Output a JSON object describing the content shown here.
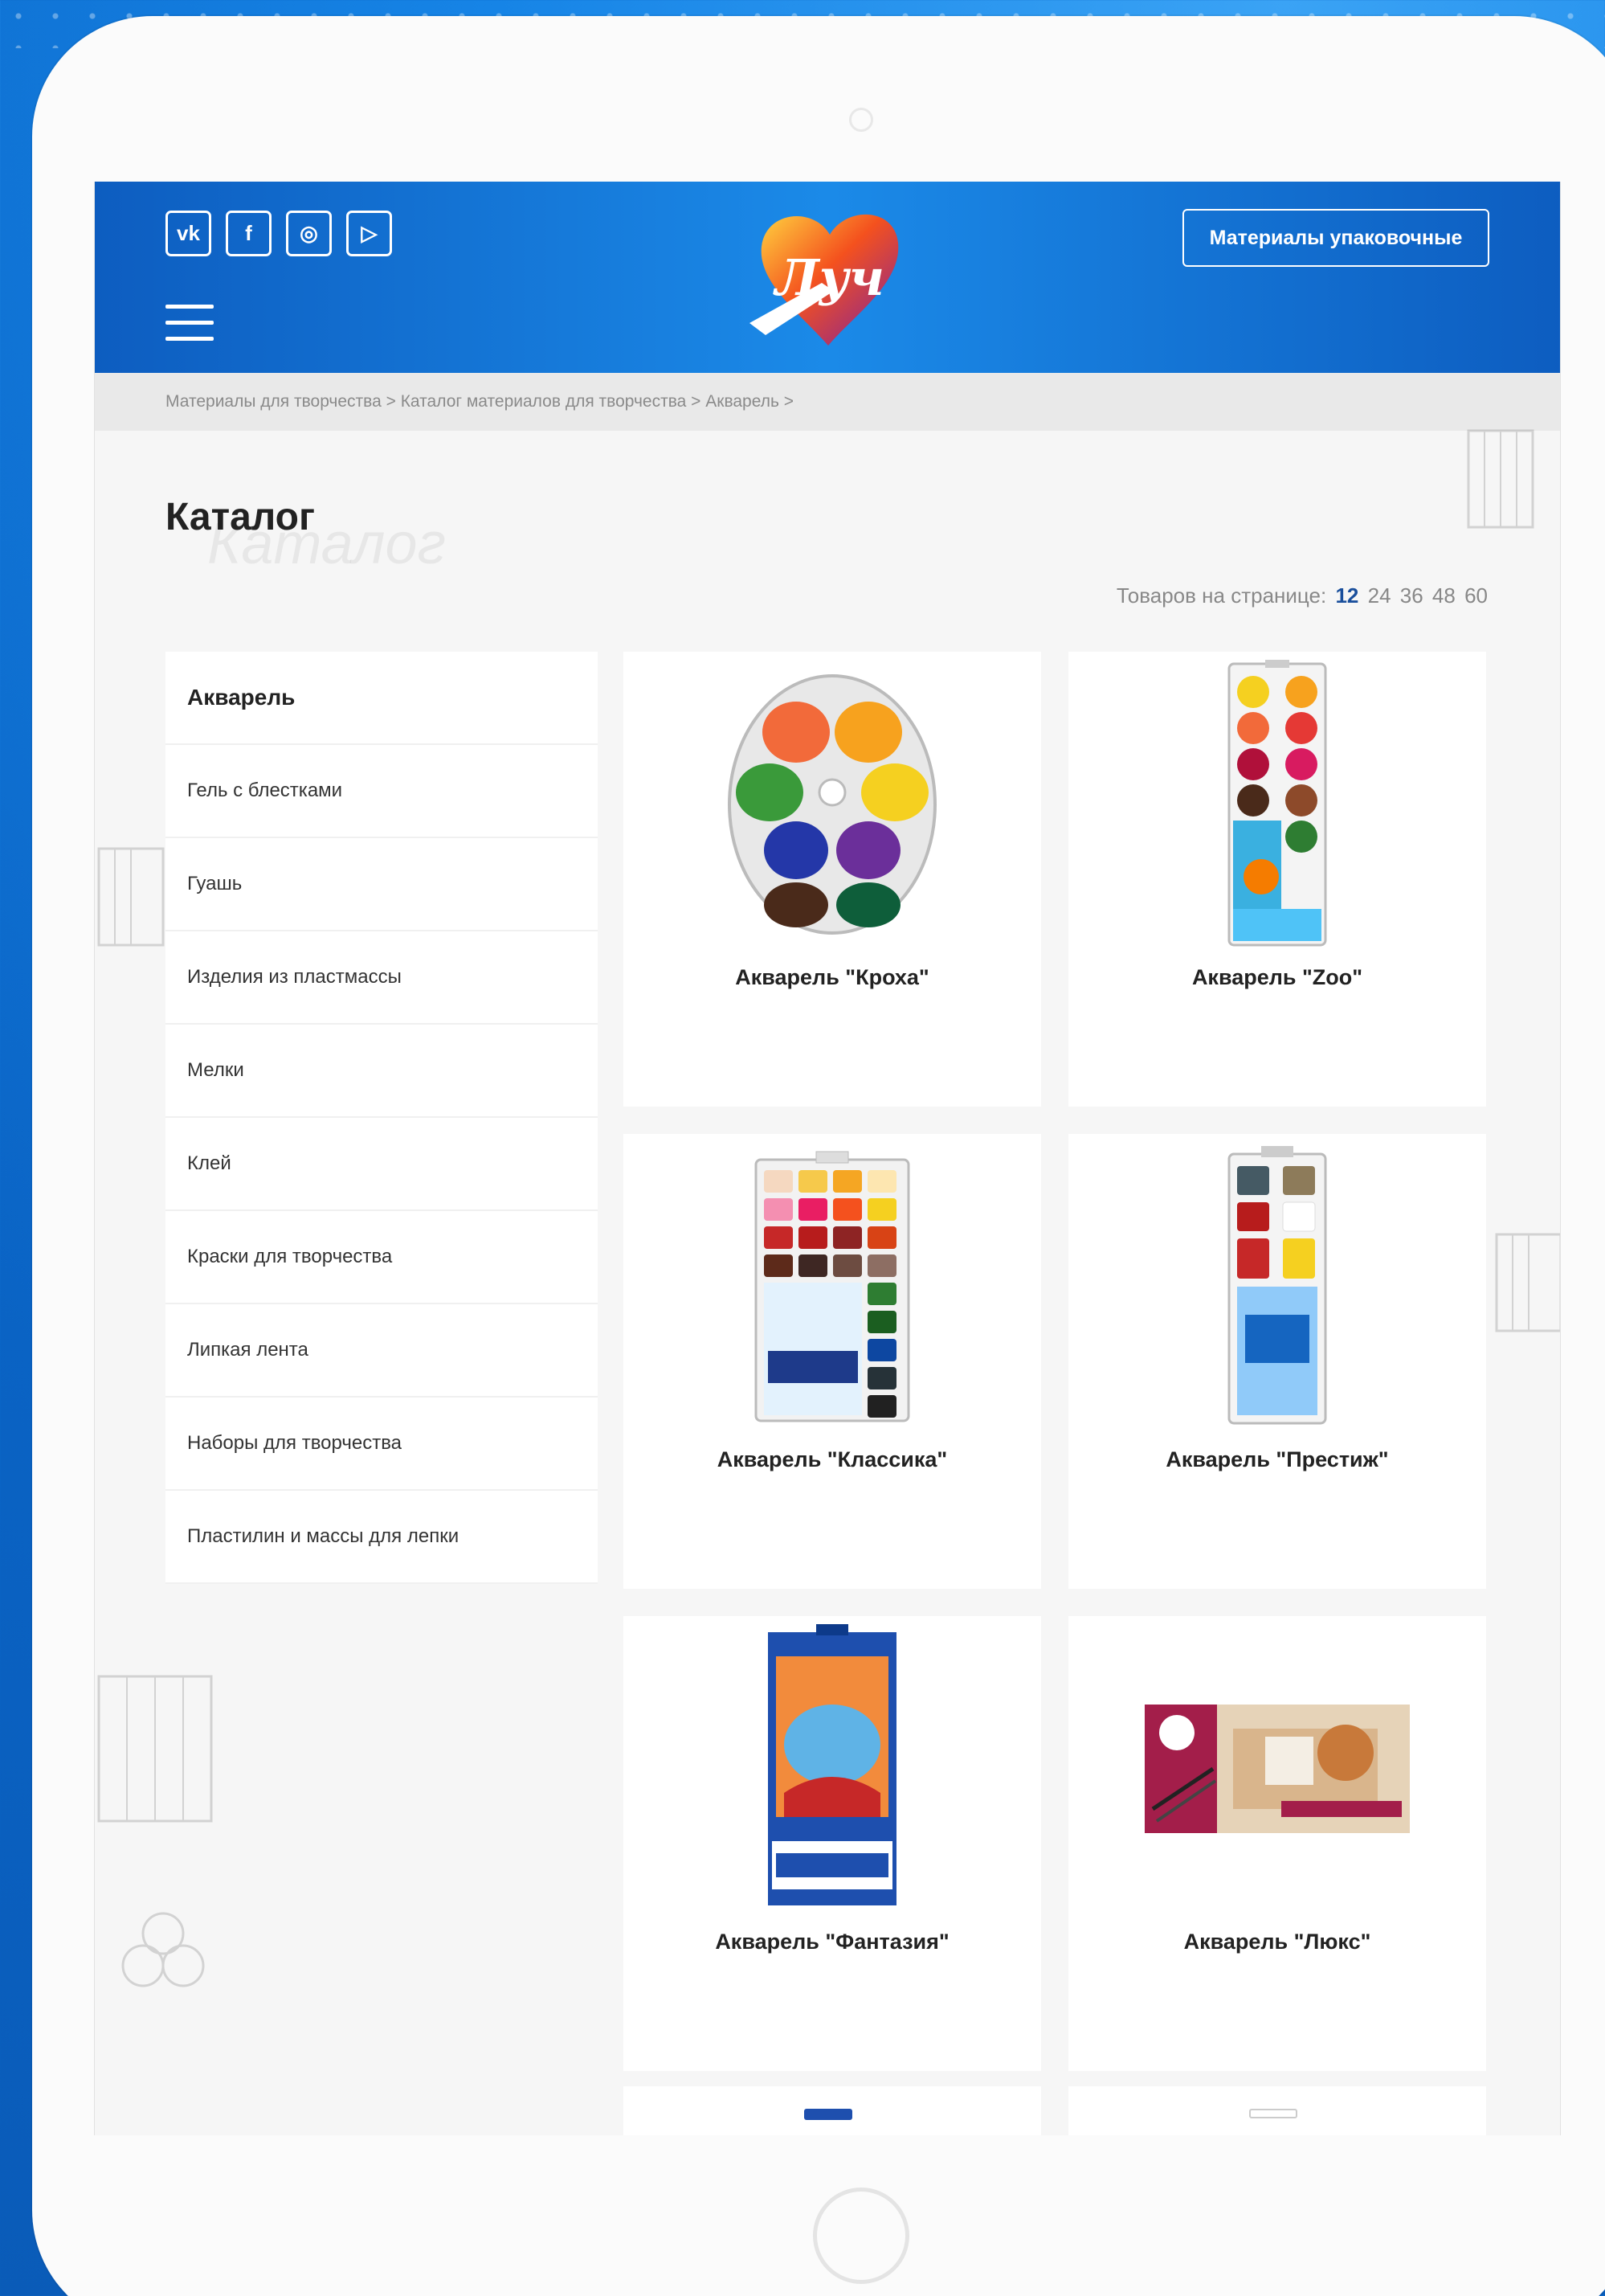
{
  "header": {
    "social": [
      {
        "icon": "vk-icon",
        "glyph": "vk"
      },
      {
        "icon": "facebook-icon",
        "glyph": "f"
      },
      {
        "icon": "instagram-icon",
        "glyph": "◎"
      },
      {
        "icon": "youtube-icon",
        "glyph": "▷"
      }
    ],
    "logo_text": "Луч",
    "pack_button": "Материалы упаковочные"
  },
  "breadcrumb": "Материалы для творчества > Каталог материалов для творчества > Акварель >",
  "page": {
    "title": "Каталог",
    "title_ghost": "Каталог"
  },
  "per_page": {
    "label": "Товаров на странице:",
    "options": [
      "12",
      "24",
      "36",
      "48",
      "60"
    ],
    "active": "12"
  },
  "sidebar": {
    "items": [
      "Акварель",
      "Гель с блестками",
      "Гуашь",
      "Изделия из пластмассы",
      "Мелки",
      "Клей",
      "Краски для творчества",
      "Липкая лента",
      "Наборы для творчества",
      "Пластилин и массы для лепки"
    ],
    "active_index": 0
  },
  "products": [
    {
      "name": "Акварель \"Кроха\""
    },
    {
      "name": "Акварель \"Zoo\""
    },
    {
      "name": "Акварель \"Классика\""
    },
    {
      "name": "Акварель \"Престиж\""
    },
    {
      "name": "Акварель \"Фантазия\""
    },
    {
      "name": "Акварель \"Люкс\""
    }
  ],
  "colors": {
    "header_blue": "#1b8ae8",
    "accent_dark": "#1a4f9c",
    "page_bg": "#f6f6f6"
  }
}
